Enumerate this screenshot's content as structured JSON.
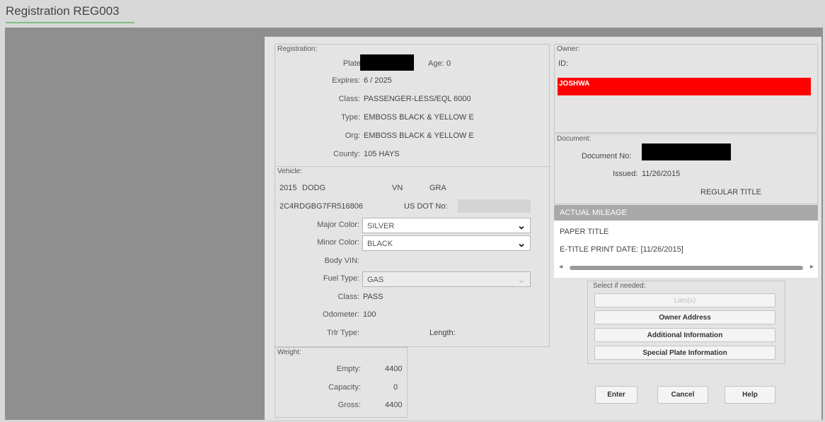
{
  "app": {
    "title": "Registration REG003"
  },
  "registration": {
    "legend": "Registration:",
    "plate_label": "Plate",
    "age_label": "Age:",
    "age_value": "0",
    "expires_label": "Expires:",
    "expires_value": "6   / 2025",
    "class_label": "Class:",
    "class_value": "PASSENGER-LESS/EQL 6000",
    "type_label": "Type:",
    "type_value": "EMBOSS BLACK & YELLOW E",
    "org_label": "Org:",
    "org_value": "EMBOSS BLACK & YELLOW E",
    "county_label": "County:",
    "county_value": "105 HAYS"
  },
  "vehicle": {
    "legend": "Vehicle:",
    "year": "2015",
    "make": "DODG",
    "vn_label": "VN",
    "model": "GRA",
    "vin": "2C4RDGBG7FR516806",
    "usdot_label": "US DOT No:",
    "usdot_value": "",
    "major_color_label": "Major Color:",
    "major_color_value": "SILVER",
    "minor_color_label": "Minor Color:",
    "minor_color_value": "BLACK",
    "body_vin_label": "Body VIN:",
    "fuel_type_label": "Fuel Type:",
    "fuel_type_value": "GAS",
    "class_label": "Class:",
    "class_value": "PASS",
    "odometer_label": "Odometer:",
    "odometer_value": "100",
    "trlr_type_label": "Trlr Type:",
    "length_label": "Length:"
  },
  "weight": {
    "legend": "Weight:",
    "empty_label": "Empty:",
    "empty_value": "4400",
    "capacity_label": "Capacity:",
    "capacity_value": "0",
    "gross_label": "Gross:",
    "gross_value": "4400"
  },
  "owner": {
    "legend": "Owner:",
    "id_label": "ID:",
    "name": "JOSHWA",
    "name_bg": "#ff0000"
  },
  "document": {
    "legend": "Document:",
    "doc_no_label": "Document No:",
    "issued_label": "Issued:",
    "issued_value": "11/26/2015",
    "title_type": "REGULAR TITLE"
  },
  "remarks": {
    "items": [
      "ACTUAL MILEAGE",
      "PAPER TITLE",
      "E-TITLE PRINT DATE:  [11/26/2015]"
    ],
    "selected_index": 0
  },
  "select_panel": {
    "legend": "Select if needed:",
    "buttons": [
      "Lien(s)",
      "Owner Address",
      "Additional Information",
      "Special Plate Information"
    ]
  },
  "actions": {
    "enter": "Enter",
    "cancel": "Cancel",
    "help": "Help"
  },
  "colors": {
    "workspace": "#8f8f8f",
    "dialog": "#e4e4e4",
    "owner_highlight": "#ff0000",
    "list_selected": "#a9a9a9"
  }
}
